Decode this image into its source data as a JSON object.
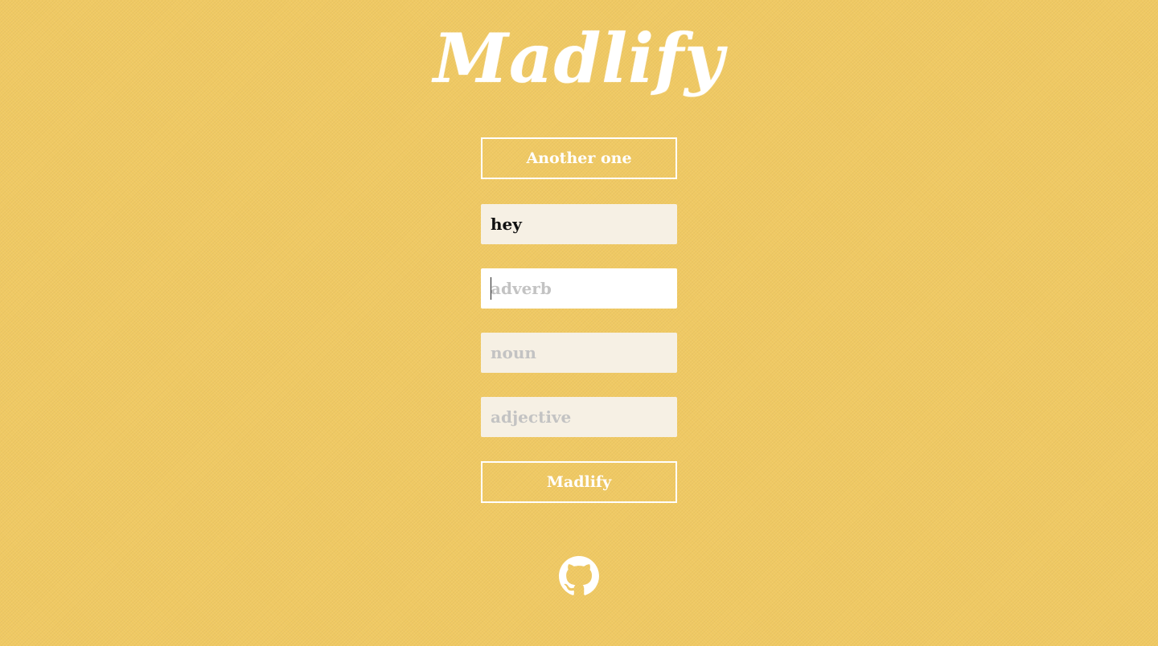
{
  "app": {
    "logo_text": "Madlify"
  },
  "buttons": {
    "another_one": "Another one",
    "madlify": "Madlify"
  },
  "inputs": [
    {
      "value": "hey",
      "placeholder": ""
    },
    {
      "value": "",
      "placeholder": "adverb"
    },
    {
      "value": "",
      "placeholder": "noun"
    },
    {
      "value": "",
      "placeholder": "adjective"
    }
  ],
  "icons": {
    "footer": "github-icon"
  },
  "colors": {
    "background": "#f0c963",
    "foreground": "#ffffff",
    "input_bg": "#f6f0e4",
    "placeholder": "#c3c3c3"
  }
}
